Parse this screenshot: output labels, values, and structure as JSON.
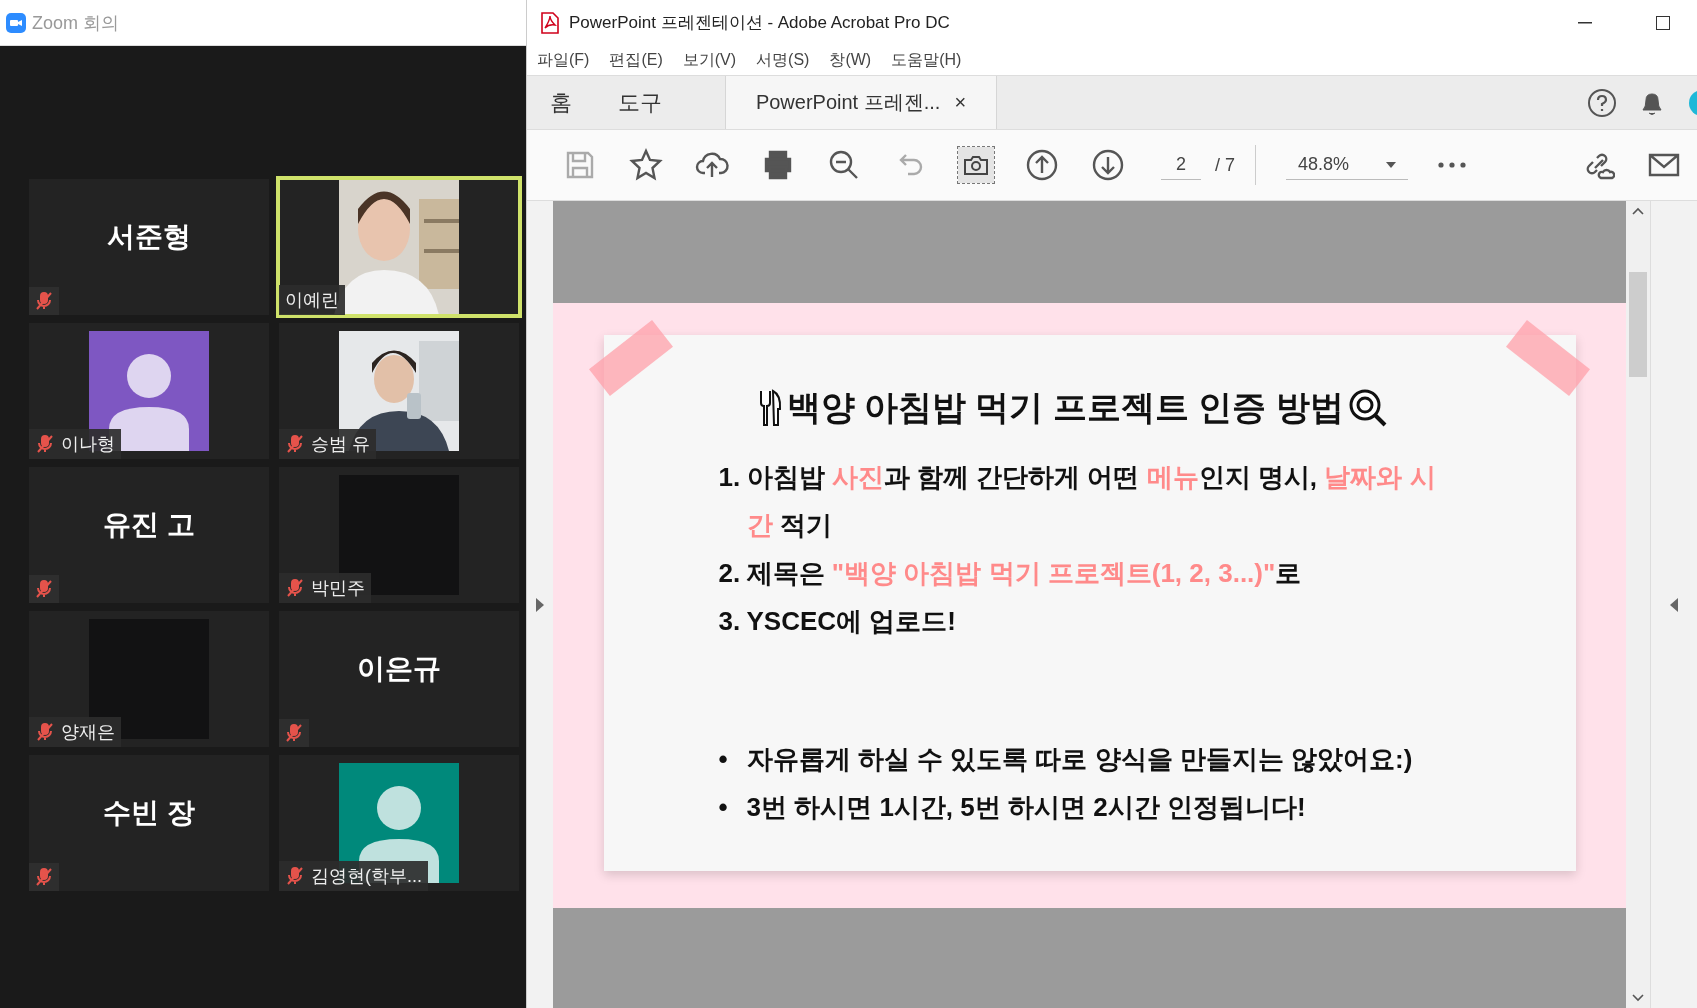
{
  "zoom_window": {
    "title": "Zoom 회의",
    "participants": [
      {
        "name": "서준형",
        "kind": "name",
        "muted": true,
        "selected": false
      },
      {
        "name": "이예린",
        "kind": "video",
        "muted": false,
        "selected": true
      },
      {
        "name": "이나형",
        "kind": "avatar",
        "color": "#7e57c2",
        "muted": true,
        "selected": false
      },
      {
        "name": "승범 유",
        "kind": "video",
        "muted": true,
        "selected": false
      },
      {
        "name": "유진 고",
        "kind": "name",
        "muted": true,
        "selected": false
      },
      {
        "name": "박민주",
        "kind": "blank",
        "muted": true,
        "selected": false
      },
      {
        "name": "양재은",
        "kind": "blank",
        "muted": true,
        "selected": false
      },
      {
        "name": "이은규",
        "kind": "name",
        "muted": true,
        "selected": false
      },
      {
        "name": "수빈 장",
        "kind": "name",
        "muted": true,
        "selected": false
      },
      {
        "name": "김영현(학부...",
        "kind": "avatar",
        "color": "#00897b",
        "muted": true,
        "selected": false
      }
    ]
  },
  "acrobat": {
    "title": "PowerPoint 프레젠테이션 - Adobe Acrobat Pro DC",
    "menu": [
      "파일(F)",
      "편집(E)",
      "보기(V)",
      "서명(S)",
      "창(W)",
      "도움말(H)"
    ],
    "tabs": [
      {
        "label": "홈",
        "selected": false
      },
      {
        "label": "도구",
        "selected": false
      }
    ],
    "document_tab": {
      "label": "PowerPoint 프레젠...",
      "close": "×"
    },
    "page_field": {
      "value": "2"
    },
    "page_total": "/ 7",
    "zoom_field": {
      "value": "48.8%"
    },
    "slide": {
      "title": "백양 아침밥 먹기 프로젝트 인증 방법",
      "items": [
        {
          "number": "1.",
          "segments": [
            {
              "text": "아침밥 ",
              "highlight": false
            },
            {
              "text": "사진",
              "highlight": true
            },
            {
              "text": "과 함께 간단하게 어떤 ",
              "highlight": false
            },
            {
              "text": "메뉴",
              "highlight": true
            },
            {
              "text": "인지 명시, ",
              "highlight": false
            },
            {
              "text": "날짜와 시간",
              "highlight": true
            },
            {
              "text": " 적기",
              "highlight": false
            }
          ]
        },
        {
          "number": "2.",
          "segments": [
            {
              "text": "제목은 ",
              "highlight": false
            },
            {
              "text": "\"백양 아침밥 먹기 프로젝트(1, 2, 3...)\"",
              "highlight": true
            },
            {
              "text": "로",
              "highlight": false
            }
          ]
        },
        {
          "number": "3.",
          "segments": [
            {
              "text": "YSCEC에 업로드!",
              "highlight": false
            }
          ]
        }
      ],
      "bullets": [
        {
          "marker": "•",
          "text": "자유롭게 하실 수 있도록 따로 양식을 만들지는 않았어요:)"
        },
        {
          "marker": "•",
          "text": "3번 하시면 1시간, 5번 하시면 2시간 인정됩니다!"
        }
      ]
    }
  }
}
